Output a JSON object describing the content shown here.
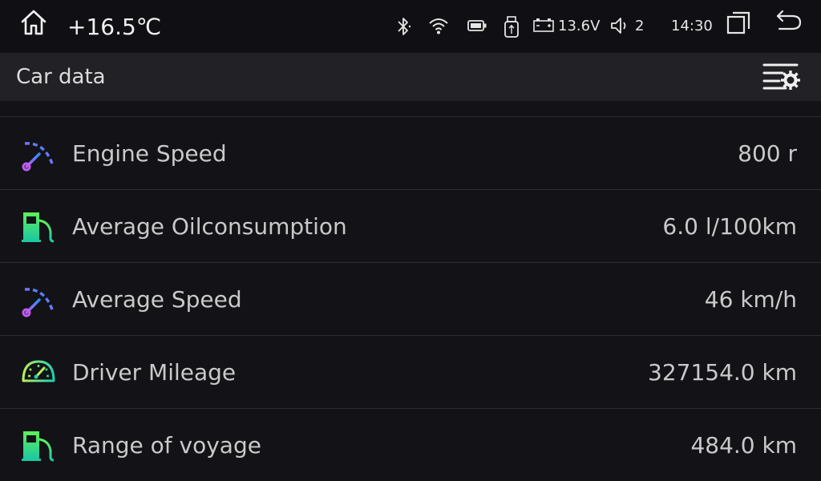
{
  "status_bar": {
    "temperature": "+16.5℃",
    "voltage": "13.6V",
    "volume": "2",
    "time": "14:30",
    "icons": [
      "home-icon",
      "bluetooth-icon",
      "wifi-icon",
      "battery-icon",
      "usb-icon",
      "car-battery-icon",
      "volume-icon",
      "recent-apps-icon",
      "back-icon"
    ]
  },
  "header": {
    "title": "Car data",
    "settings_icon": "list-settings-icon"
  },
  "rows": [
    {
      "label": "Engine Speed",
      "value": "800 r",
      "icon": "speed-gauge-icon"
    },
    {
      "label": "Average Oilconsumption",
      "value": "6.0 l/100km",
      "icon": "fuel-pump-icon"
    },
    {
      "label": "Average Speed",
      "value": "46 km/h",
      "icon": "speed-gauge-icon"
    },
    {
      "label": "Driver Mileage",
      "value": "327154.0 km",
      "icon": "speedometer-icon"
    },
    {
      "label": "Range of voyage",
      "value": "484.0 km",
      "icon": "fuel-pump-icon"
    }
  ],
  "colors": {
    "background": "#121217",
    "header_bg": "#222226",
    "text": "#c9c9c9",
    "accent_blue": "#2a8cff",
    "accent_purple": "#b05cf0",
    "accent_green": "#2ee07a"
  }
}
